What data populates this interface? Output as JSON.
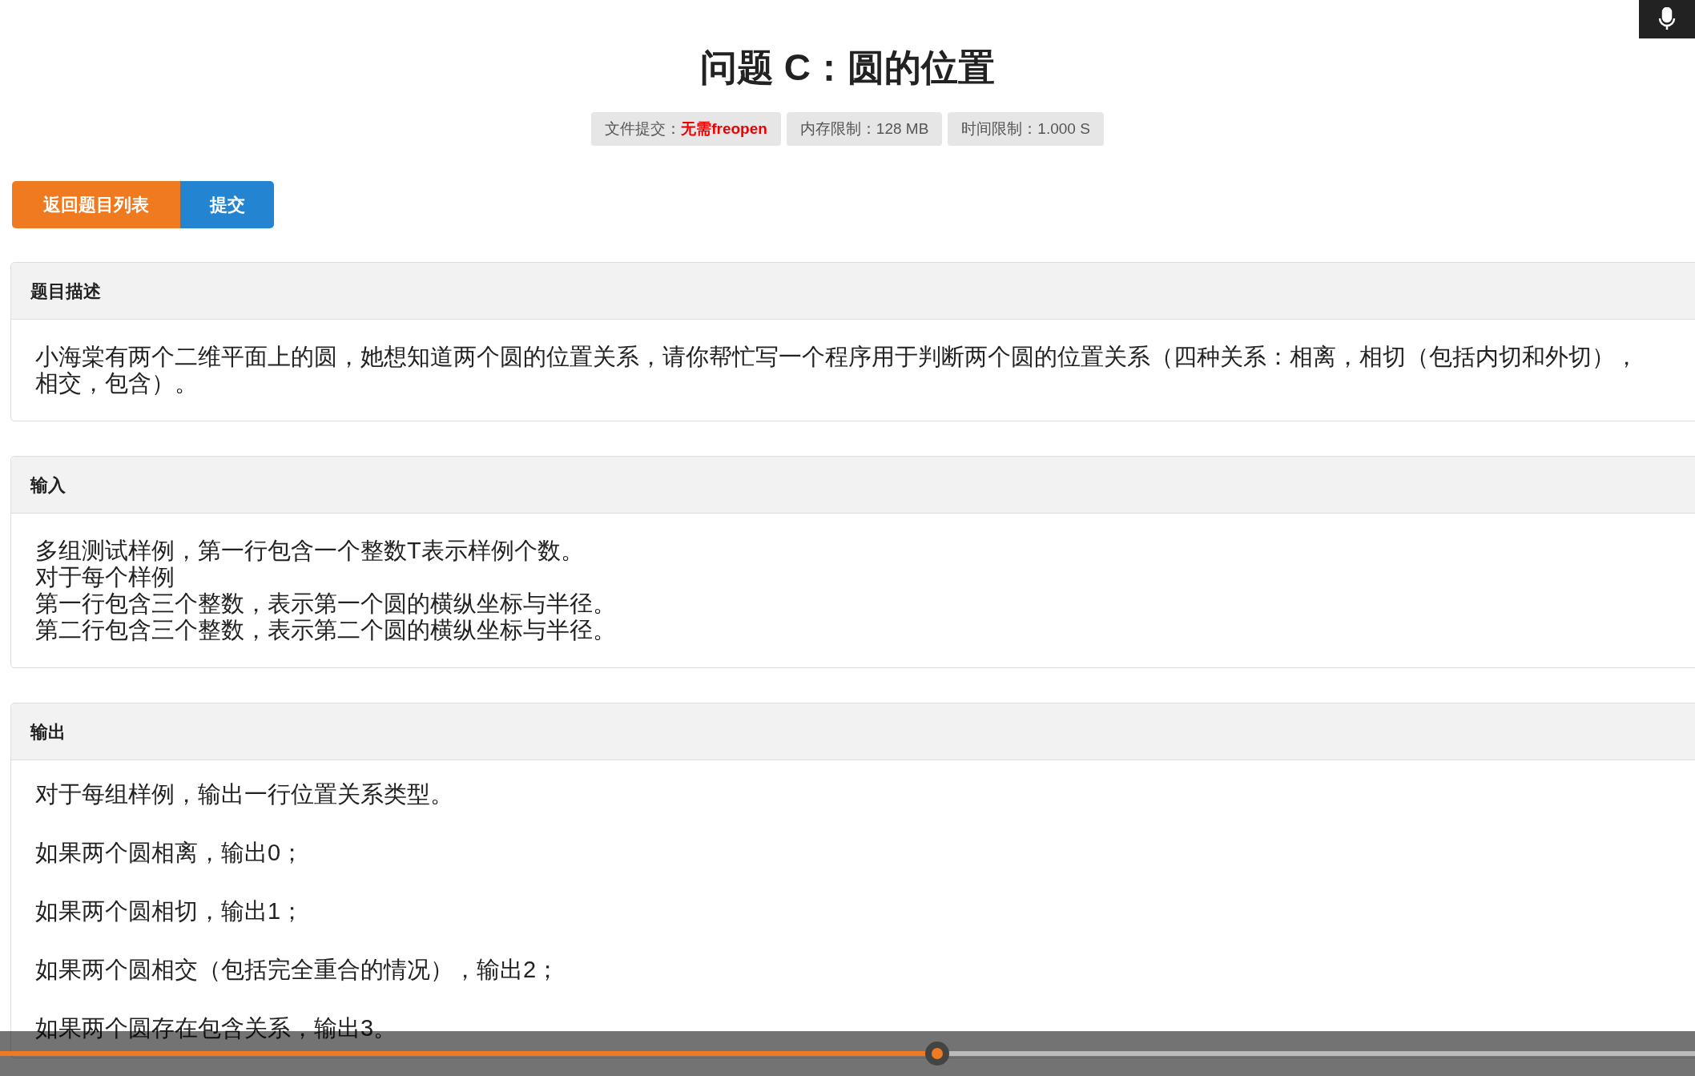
{
  "title": "问题 C：圆的位置",
  "limits": [
    {
      "label": "文件提交：",
      "value": "无需freopen",
      "highlight": true
    },
    {
      "label": "内存限制：",
      "value": "128 MB",
      "highlight": false
    },
    {
      "label": "时间限制：",
      "value": "1.000 S",
      "highlight": false
    }
  ],
  "buttons": [
    {
      "label": "返回题目列表",
      "kind": "back"
    },
    {
      "label": "提交",
      "kind": "submit"
    }
  ],
  "sections": [
    {
      "heading": "题目描述",
      "kind": "lines",
      "lines": [
        "小海棠有两个二维平面上的圆，她想知道两个圆的位置关系，请你帮忙写一个程序用于判断两个圆的位置关系（四种关系：相离，相切（包括内切和外切），相交，包含）。"
      ]
    },
    {
      "heading": "输入",
      "kind": "lines",
      "lines": [
        "多组测试样例，第一行包含一个整数T表示样例个数。",
        "对于每个样例",
        "第一行包含三个整数，表示第一个圆的横纵坐标与半径。",
        "第二行包含三个整数，表示第二个圆的横纵坐标与半径。"
      ]
    },
    {
      "heading": "输出",
      "kind": "paragraphs",
      "lines": [
        "对于每组样例，输出一行位置关系类型。",
        "如果两个圆相离，输出0；",
        "如果两个圆相切，输出1；",
        "如果两个圆相交（包括完全重合的情况），输出2；",
        "如果两个圆存在包含关系，输出3。"
      ]
    }
  ],
  "player": {
    "level": 0.553
  }
}
